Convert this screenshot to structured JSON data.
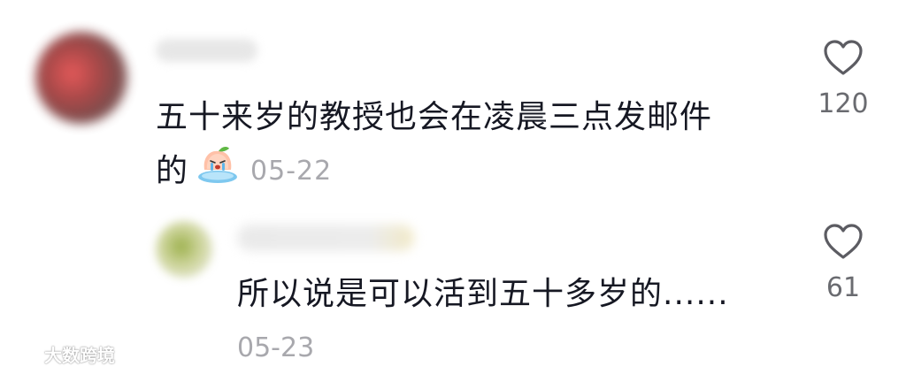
{
  "comment": {
    "text_line1": "五十来岁的教授也会在凌晨三点发邮件",
    "text_line2": "的",
    "emoji": "crying-peach-emoji",
    "date": "05-22",
    "likes": "120"
  },
  "reply": {
    "text": "所以说是可以活到五十多岁的......",
    "date": "05-23",
    "likes": "61"
  },
  "watermark": {
    "text": "大数跨境"
  },
  "colors": {
    "text_primary": "#161823",
    "text_secondary": "#a8a8ad",
    "like_count": "#6a6b70",
    "heart_outline": "#5c5c62"
  },
  "icons": {
    "like": "heart-outline-icon",
    "watermark_logo": "watermark-logo-icon"
  }
}
